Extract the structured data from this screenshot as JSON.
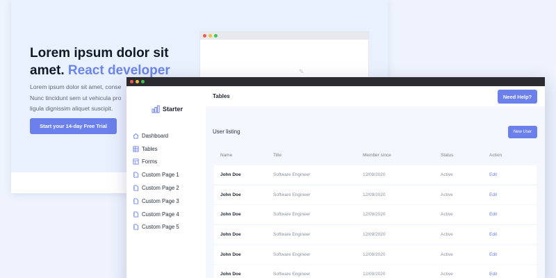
{
  "landing": {
    "hero_title": "Lorem ipsum dolor sit amet.",
    "hero_title_accent": "React developer",
    "hero_body_lines": [
      "Lorem ipsum dolor sit amet, conse",
      "Nunc tincidunt sem ut vehicula pro",
      "ligula dignissim aliquet suscipit."
    ],
    "cta_label": "Start your 14-day Free Trial"
  },
  "app": {
    "brand": "Starter",
    "nav": [
      {
        "label": "Dashboard",
        "icon": "home-icon"
      },
      {
        "label": "Tables",
        "icon": "table-icon"
      },
      {
        "label": "Forms",
        "icon": "form-icon"
      },
      {
        "label": "Custom Page 1",
        "icon": "page-icon"
      },
      {
        "label": "Custom Page 2",
        "icon": "page-icon"
      },
      {
        "label": "Custom Page 3",
        "icon": "page-icon"
      },
      {
        "label": "Custom Page 4",
        "icon": "page-icon"
      },
      {
        "label": "Custom Page 5",
        "icon": "page-icon"
      }
    ],
    "page_title": "Tables",
    "help_label": "Need Help?",
    "section_title": "User listing",
    "new_user_label": "New User",
    "table": {
      "headers": [
        "Name",
        "Title",
        "Member since",
        "Status",
        "Action"
      ],
      "rows": [
        [
          "John Doe",
          "Software Engineer",
          "12/09/2020",
          "Active",
          "Edit"
        ],
        [
          "John Doe",
          "Software Engineer",
          "12/09/2020",
          "Active",
          "Edit"
        ],
        [
          "John Doe",
          "Software Engineer",
          "12/09/2020",
          "Active",
          "Edit"
        ],
        [
          "John Doe",
          "Software Engineer",
          "12/09/2020",
          "Active",
          "Edit"
        ],
        [
          "John Doe",
          "Software Engineer",
          "12/09/2020",
          "Active",
          "Edit"
        ],
        [
          "John Doe",
          "Software Engineer",
          "12/09/2020",
          "Active",
          "Edit"
        ]
      ]
    }
  },
  "colors": {
    "accent": "#6b80ea",
    "background": "#eef3fd",
    "titlebar": "#2b2b2f"
  }
}
